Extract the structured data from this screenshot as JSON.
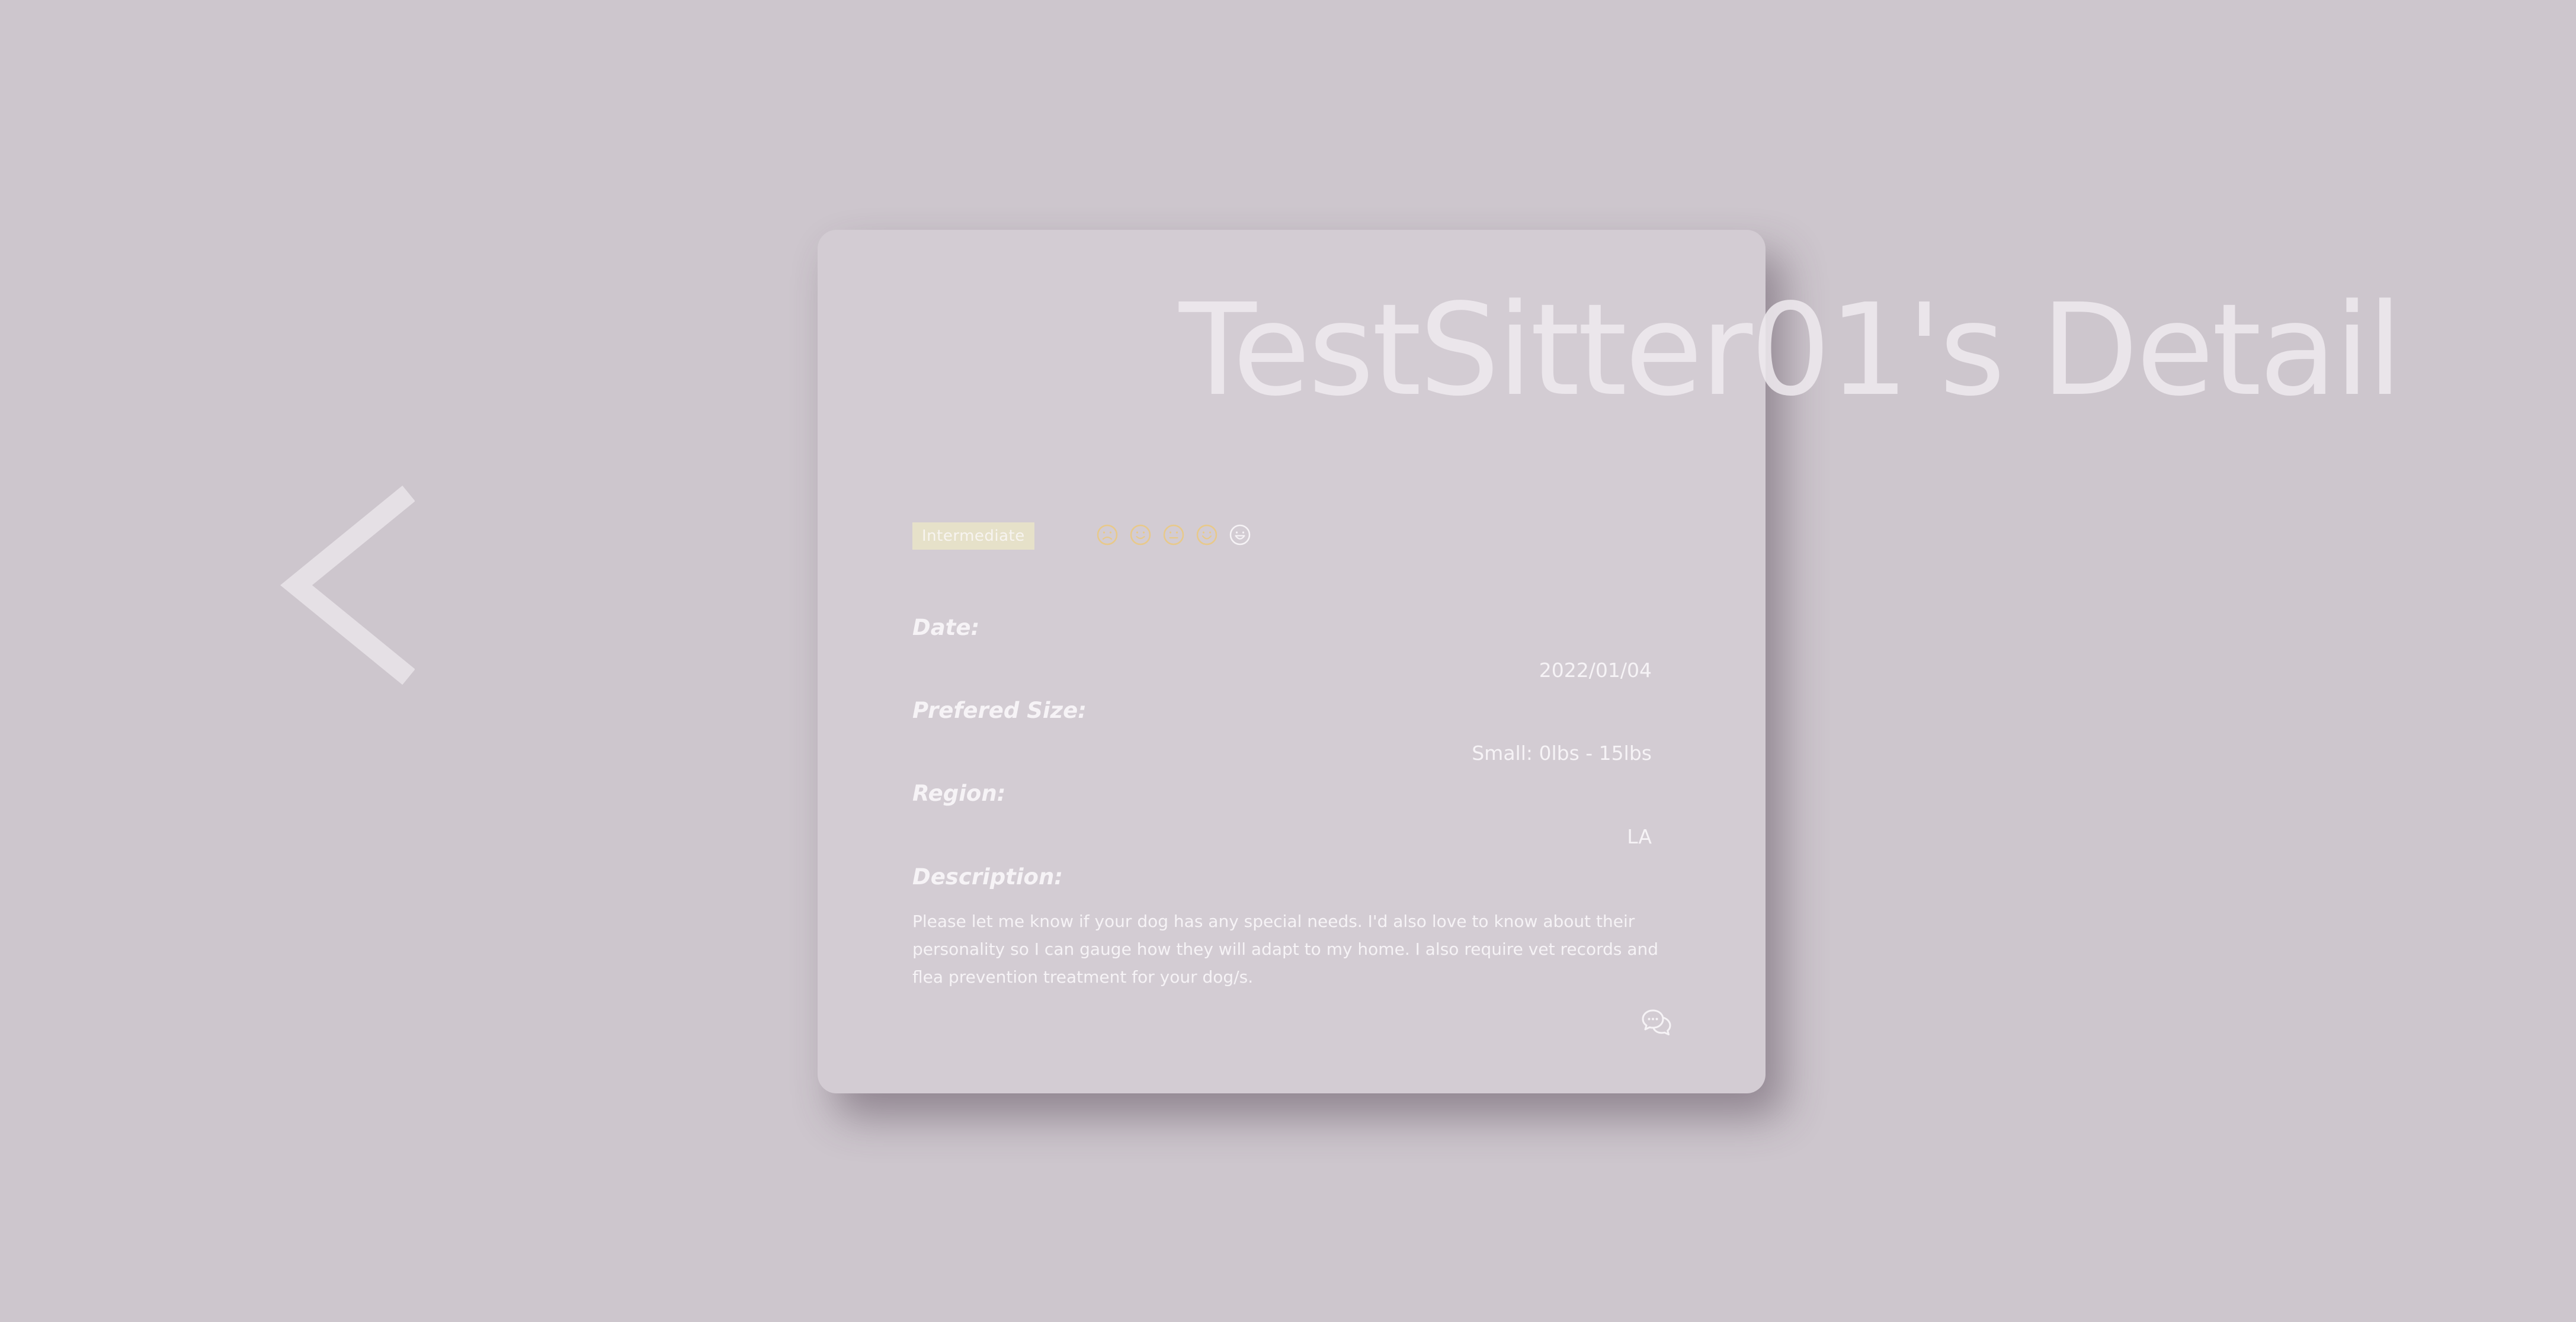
{
  "page": {
    "title": "TestSitter01's Detail"
  },
  "navigation": {
    "back_icon": "chevron-left-icon"
  },
  "profile": {
    "level_badge": "Intermediate",
    "rating": {
      "scale": 5,
      "icons": [
        "sad-face-icon",
        "smile-face-icon",
        "neutral-face-icon",
        "happy-face-icon",
        "grin-face-icon"
      ],
      "active_color": "#e8c98a",
      "inactive_color": "#f6f3f6"
    }
  },
  "details": {
    "date_label": "Date:",
    "date_value": "2022/01/04",
    "size_label": "Prefered Size:",
    "size_value": "Small: 0lbs - 15lbs",
    "region_label": "Region:",
    "region_value": "LA",
    "description_label": "Description:",
    "description_value": "Please let me know if your dog has any special needs. I'd also love to know about their personality so I can gauge how they will adapt to my home. I also require vet records and flea prevention treatment for your dog/s."
  },
  "actions": {
    "chat_icon": "chat-bubbles-icon"
  },
  "colors": {
    "background": "#cdc6cd",
    "card": "#d3ccd3",
    "badge": "#e6e1c9",
    "text": "#f6f3f6"
  }
}
